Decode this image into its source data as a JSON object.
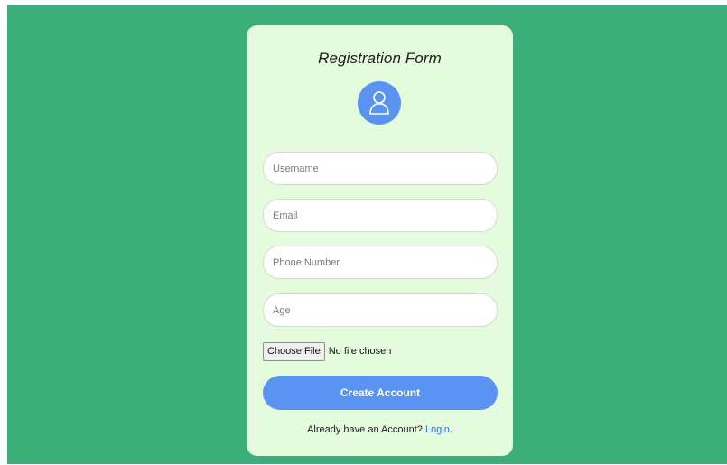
{
  "form": {
    "title": "Registration Form",
    "fields": {
      "username_placeholder": "Username",
      "email_placeholder": "Email",
      "phone_placeholder": "Phone Number",
      "age_placeholder": "Age"
    },
    "file": {
      "button_label": "Choose File",
      "status": "No file chosen"
    },
    "submit_label": "Create Account",
    "footer": {
      "prompt": "Already have an Account?",
      "link_label": "Login",
      "suffix": "."
    }
  },
  "icons": {
    "avatar": "user-icon"
  },
  "colors": {
    "page_background": "#3bae79",
    "card_background": "#e4fbdd",
    "accent": "#5b93f3",
    "link": "#2f6fe3"
  }
}
